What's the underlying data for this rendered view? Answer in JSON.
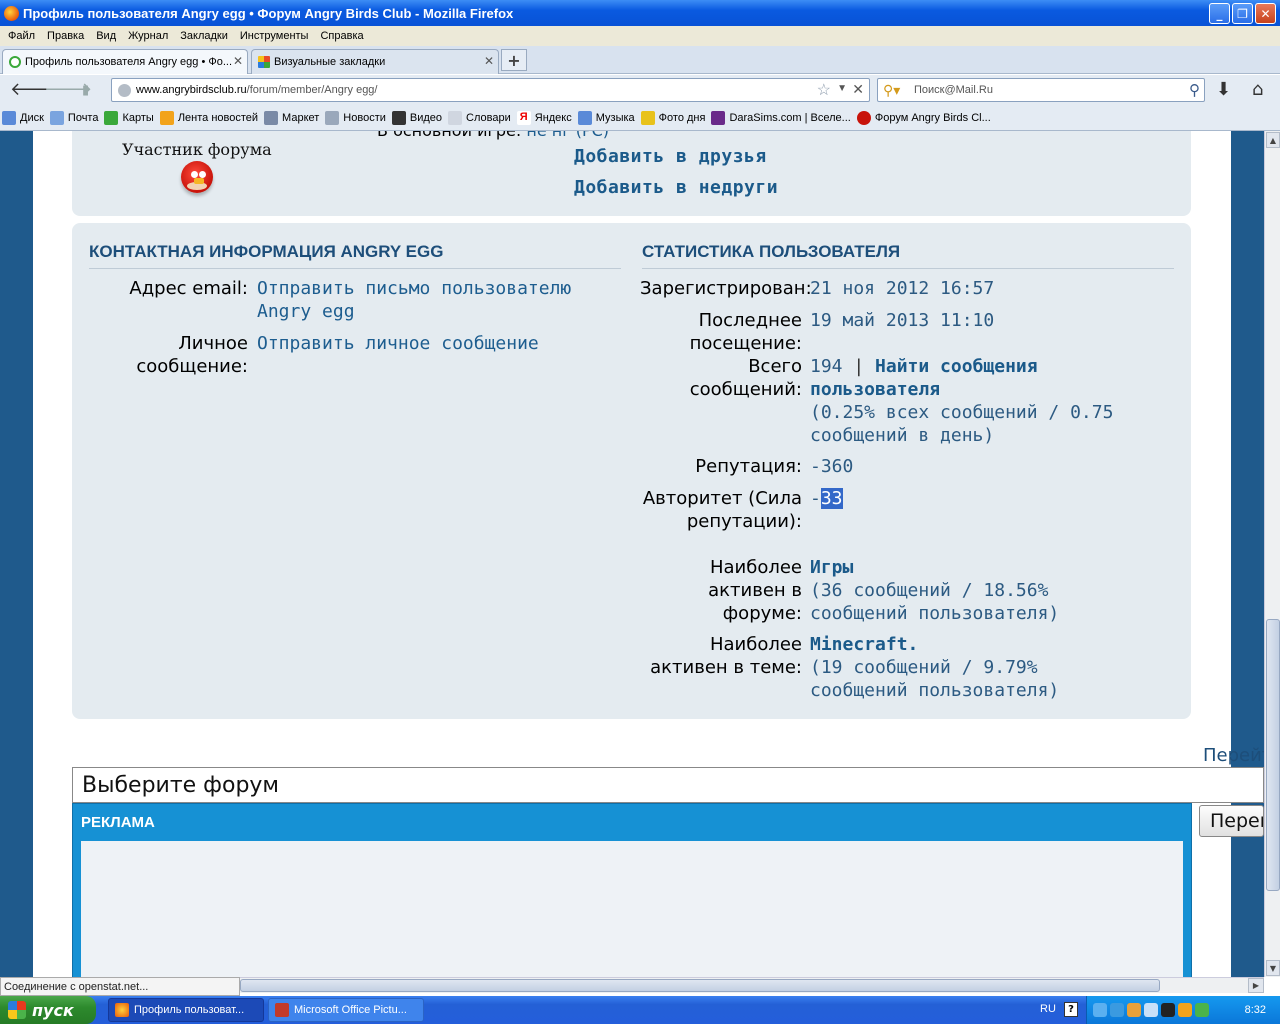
{
  "window": {
    "title": "Профиль пользователя Angry egg • Форум Angry Birds Club - Mozilla Firefox"
  },
  "menu": [
    "Файл",
    "Правка",
    "Вид",
    "Журнал",
    "Закладки",
    "Инструменты",
    "Справка"
  ],
  "tabs": [
    {
      "label": "Профиль пользователя Angry egg • Фо...",
      "active": true
    },
    {
      "label": "Визуальные закладки",
      "active": false
    }
  ],
  "nav": {
    "url_domain": "www.angrybirdsclub.ru",
    "url_path": "/forum/member/Angry egg/",
    "search_placeholder": "Поиск@Mail.Ru"
  },
  "bookmarks": [
    "Диск",
    "Почта",
    "Карты",
    "Лента новостей",
    "Маркет",
    "Новости",
    "Видео",
    "Словари",
    "Яндекс",
    "Музыка",
    "Фото дня",
    "DaraSims.com | Вселе...",
    "Форум Angry Birds Cl..."
  ],
  "profile": {
    "partial_label": "В основной игре:",
    "partial_value": "не нг (РС)",
    "rank": "Участник форума",
    "add_friend": "Добавить в друзья",
    "add_foe": "Добавить в недруги"
  },
  "contact": {
    "heading": "КОНТАКТНАЯ ИНФОРМАЦИЯ ANGRY EGG",
    "email_label": "Адрес email:",
    "email_link": "Отправить письмо пользователю Angry egg",
    "pm_label": "Личное сообщение:",
    "pm_link": "Отправить личное сообщение"
  },
  "stats": {
    "heading": "СТАТИСТИКА ПОЛЬЗОВАТЕЛЯ",
    "registered_label": "Зарегистрирован:",
    "registered_value": "21 ноя 2012 16:57",
    "last_visit_label": "Последнее посещение:",
    "last_visit_value": "19 май 2013 11:10",
    "posts_label": "Всего сообщений:",
    "posts_count": "194",
    "posts_sep": " | ",
    "posts_link": "Найти сообщения пользователя",
    "posts_detail": "(0.25% всех сообщений / 0.75 сообщений в день)",
    "reputation_label": "Репутация:",
    "reputation_value": "-360",
    "authority_label": "Авторитет (Сила репутации):",
    "authority_sign": "-",
    "authority_value": "33",
    "active_forum_label": "Наиболее активен в форуме:",
    "active_forum_link": "Игры",
    "active_forum_detail": "(36 сообщений / 18.56% сообщений пользователя)",
    "active_topic_label": "Наиболее активен в теме:",
    "active_topic_link": "Minecraft.",
    "active_topic_detail": "(19 сообщений / 9.79% сообщений пользователя)"
  },
  "footer": {
    "goto_text": "Перейти",
    "forum_select": "Выберите форум",
    "ad_title": "РЕКЛАМА",
    "go_button": "Перейти"
  },
  "statusbar": "Соединение с openstat.net...",
  "taskbar": {
    "start": "пуск",
    "tasks": [
      "Профиль пользоват...",
      "Microsoft Office Pictu..."
    ],
    "lang": "RU",
    "clock": "8:32"
  }
}
